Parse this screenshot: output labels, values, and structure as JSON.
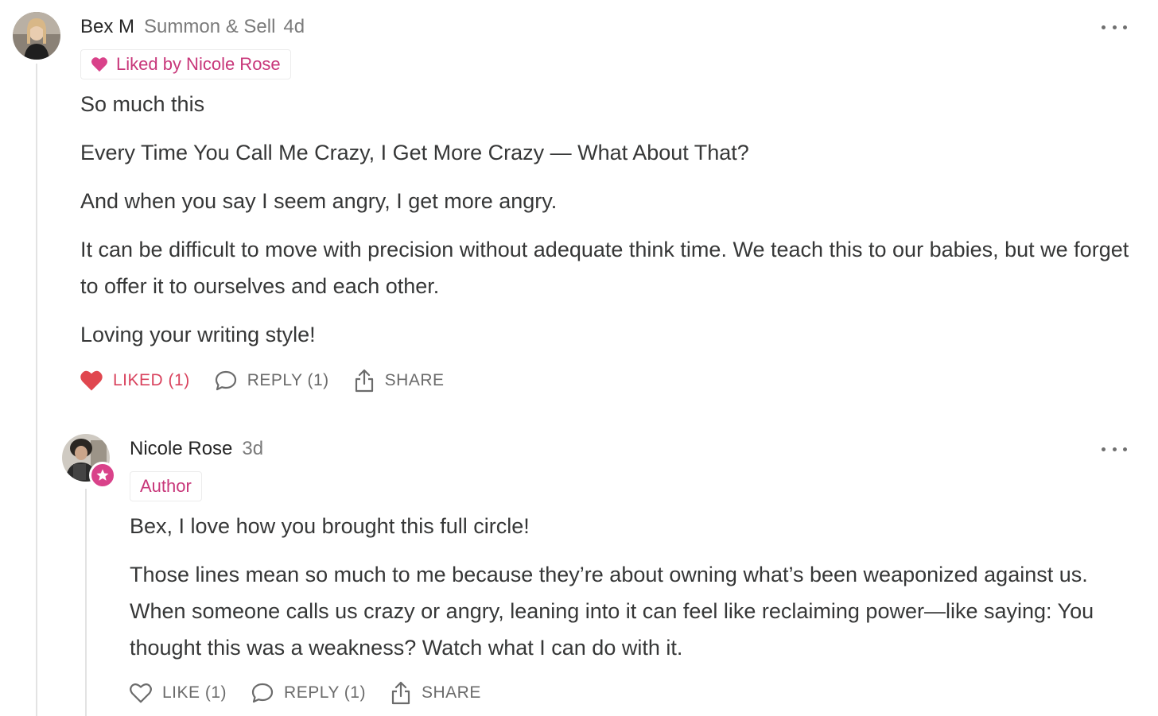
{
  "comments": [
    {
      "user": "Bex M",
      "publication": "Summon & Sell",
      "time": "4d",
      "badge": "Liked by Nicole Rose",
      "paragraphs": [
        "So much this",
        "Every Time You Call Me Crazy, I Get More Crazy — What About That?",
        "And when you say I seem angry, I get more angry.",
        "It can be difficult to move with precision without adequate think time. We teach this to our babies, but we forget to offer it to ourselves and each other.",
        "Loving your writing style!"
      ],
      "actions": {
        "like": "LIKED (1)",
        "reply": "REPLY (1)",
        "share": "SHARE"
      }
    },
    {
      "user": "Nicole Rose",
      "time": "3d",
      "badge": "Author",
      "paragraphs": [
        "Bex, I love how you brought this full circle!",
        "Those lines mean so much to me because they’re about owning what’s been weaponized against us. When someone calls us crazy or angry, leaning into it can feel like reclaiming power—like saying: You thought this was a weakness? Watch what I can do with it."
      ],
      "actions": {
        "like": "LIKE (1)",
        "reply": "REPLY (1)",
        "share": "SHARE"
      }
    }
  ],
  "colors": {
    "accent": "#d9428a",
    "liked": "#d9435e",
    "text": "#363737",
    "muted": "#7a7a7a"
  }
}
